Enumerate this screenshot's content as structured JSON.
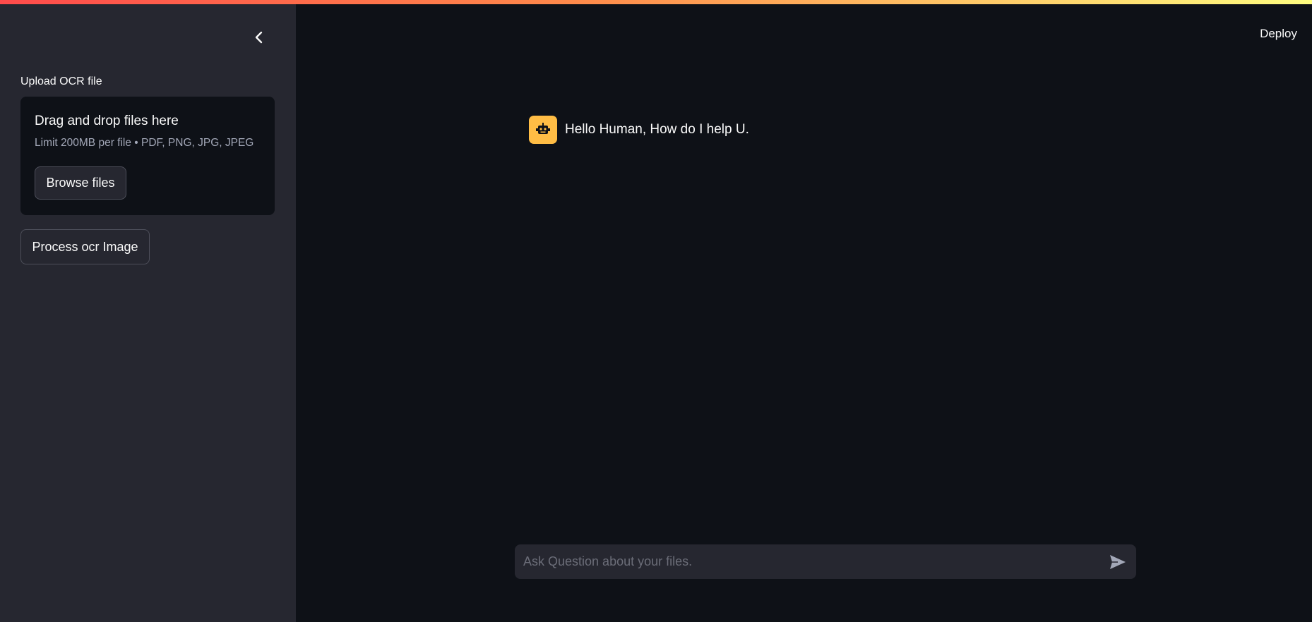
{
  "colors": {
    "sidebar_bg": "#262730",
    "main_bg": "#0e1117",
    "accent_gradient": [
      "#ff4b4b",
      "#fffd80"
    ],
    "avatar_bg": "#ffbd45"
  },
  "header": {
    "deploy_label": "Deploy"
  },
  "sidebar": {
    "collapse_icon": "chevron-left-icon",
    "upload": {
      "label": "Upload OCR file",
      "drop_title": "Drag and drop files here",
      "limit_text": "Limit 200MB per file • PDF, PNG, JPG, JPEG",
      "browse_label": "Browse files"
    },
    "process_button_label": "Process ocr Image"
  },
  "chat": {
    "messages": [
      {
        "role": "assistant",
        "avatar_icon": "robot-icon",
        "text": "Hello Human, How do I help U."
      }
    ],
    "input": {
      "placeholder": "Ask Question about your files.",
      "value": "",
      "send_icon": "send-icon"
    }
  }
}
